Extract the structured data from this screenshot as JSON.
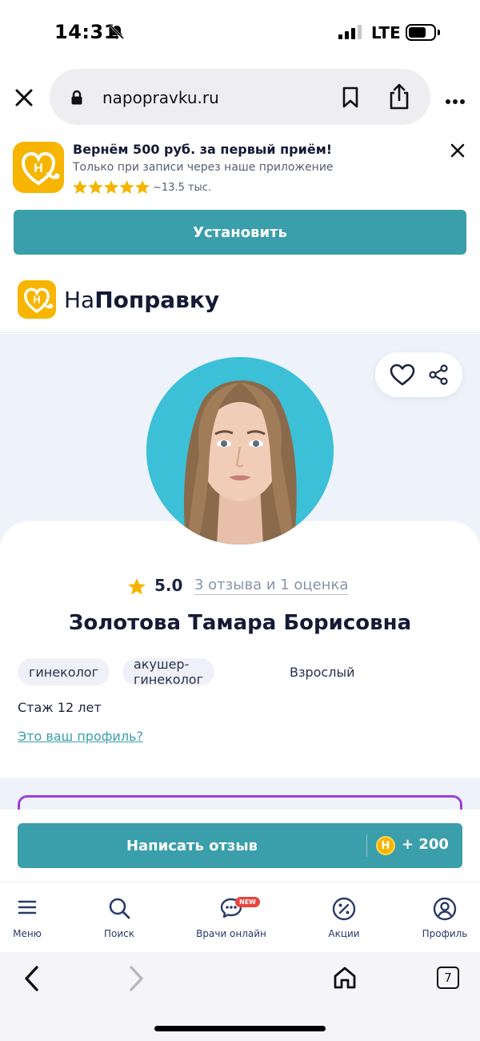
{
  "status_bar": {
    "time": "14:31",
    "network": "LTE"
  },
  "browser": {
    "url": "napopravku.ru"
  },
  "promo": {
    "title": "Вернём 500 руб. за первый приём!",
    "subtitle": "Только при записи через наше приложение",
    "rating_stars": 5,
    "rating_count": "~13.5 тыс.",
    "install_label": "Установить",
    "app_icon_letter": "Н"
  },
  "site": {
    "logo_prefix": "На",
    "logo_bold": "Поправку"
  },
  "doctor": {
    "rating": "5.0",
    "reviews_link": "3 отзыва и 1 оценка",
    "name": "Золотова Тамара Борисовна",
    "tags": [
      "гинеколог",
      "акушер-гинеколог"
    ],
    "age_group": "Взрослый",
    "experience": "Стаж 12 лет",
    "profile_link": "Это ваш профиль?"
  },
  "review_bar": {
    "button_label": "Написать отзыв",
    "coin_letter": "Н",
    "bonus": "+ 200"
  },
  "bottom_nav": {
    "items": [
      {
        "label": "Меню",
        "icon": "menu-icon"
      },
      {
        "label": "Поиск",
        "icon": "search-icon"
      },
      {
        "label": "Врачи онлайн",
        "icon": "chat-icon",
        "badge": "NEW"
      },
      {
        "label": "Акции",
        "icon": "percent-icon"
      },
      {
        "label": "Профиль",
        "icon": "profile-icon"
      }
    ]
  },
  "safari": {
    "tab_count": "7"
  },
  "colors": {
    "accent": "#3a9eab",
    "brand_yellow": "#f7b500",
    "star": "#f5b400",
    "link": "#3a9eab"
  }
}
